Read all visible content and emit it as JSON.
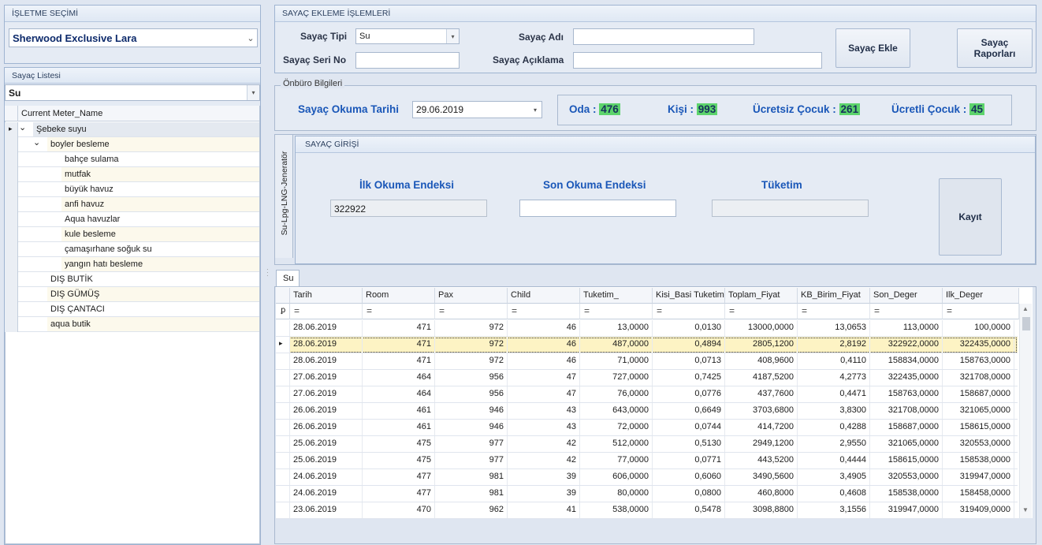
{
  "business": {
    "title": "İŞLETME SEÇİMİ",
    "selected": "Sherwood Exclusive Lara"
  },
  "meterList": {
    "title": "Sayaç Listesi",
    "filter": "Su",
    "column": "Current Meter_Name",
    "items": [
      {
        "label": "Şebeke suyu",
        "level": 0,
        "expand": "⌄"
      },
      {
        "label": "boyler besleme",
        "level": 1,
        "expand": "⌄"
      },
      {
        "label": "bahçe sulama",
        "level": 2
      },
      {
        "label": "mutfak",
        "level": 2
      },
      {
        "label": "büyük havuz",
        "level": 2
      },
      {
        "label": "anfi havuz",
        "level": 2
      },
      {
        "label": "Aqua havuzlar",
        "level": 2
      },
      {
        "label": "kule besleme",
        "level": 2
      },
      {
        "label": "çamaşırhane soğuk su",
        "level": 2
      },
      {
        "label": "yangın hatı besleme",
        "level": 2
      },
      {
        "label": "DIŞ BUTİK",
        "level": 1
      },
      {
        "label": "DIŞ GÜMÜŞ",
        "level": 1
      },
      {
        "label": "DIŞ ÇANTACI",
        "level": 1
      },
      {
        "label": "aqua butik",
        "level": 1
      }
    ]
  },
  "add": {
    "title": "SAYAÇ EKLEME İŞLEMLERİ",
    "typeLabel": "Sayaç Tipi",
    "typeValue": "Su",
    "serialLabel": "Sayaç Seri No",
    "serialValue": "",
    "nameLabel": "Sayaç Adı",
    "nameValue": "",
    "descLabel": "Sayaç Açıklama",
    "descValue": "",
    "addButton": "Sayaç Ekle",
    "reportButton": "Sayaç Raporları"
  },
  "frontOffice": {
    "title": "Önbüro Bilgileri",
    "dateLabel": "Sayaç Okuma Tarihi",
    "dateValue": "29.06.2019",
    "odaLabel": "Oda :",
    "odaValue": "476",
    "kisiLabel": "Kişi :",
    "kisiValue": "993",
    "freeChildLabel": "Ücretsiz Çocuk :",
    "freeChildValue": "261",
    "paidChildLabel": "Ücretli Çocuk :",
    "paidChildValue": "45"
  },
  "entry": {
    "sideTab": "Su-Lpg-LNG-Jeneratör",
    "title": "SAYAÇ GİRİŞİ",
    "firstLabel": "İlk Okuma Endeksi",
    "firstValue": "322922",
    "lastLabel": "Son Okuma Endeksi",
    "lastValue": "",
    "usageLabel": "Tüketim",
    "usageValue": "",
    "saveButton": "Kayıt"
  },
  "grid": {
    "tab": "Su",
    "columns": [
      "Tarih",
      "Room",
      "Pax",
      "Child",
      "Tuketim_",
      "Kisi_Basi Tuketim",
      "Toplam_Fiyat",
      "KB_Birim_Fiyat",
      "Son_Deger",
      "Ilk_Deger"
    ],
    "filterSymbol": "=",
    "filterRowIcon": "ꝑ",
    "rows": [
      [
        "28.06.2019",
        "471",
        "972",
        "46",
        "13,0000",
        "0,0130",
        "13000,0000",
        "13,0653",
        "113,0000",
        "100,0000"
      ],
      [
        "28.06.2019",
        "471",
        "972",
        "46",
        "487,0000",
        "0,4894",
        "2805,1200",
        "2,8192",
        "322922,0000",
        "322435,0000"
      ],
      [
        "28.06.2019",
        "471",
        "972",
        "46",
        "71,0000",
        "0,0713",
        "408,9600",
        "0,4110",
        "158834,0000",
        "158763,0000"
      ],
      [
        "27.06.2019",
        "464",
        "956",
        "47",
        "727,0000",
        "0,7425",
        "4187,5200",
        "4,2773",
        "322435,0000",
        "321708,0000"
      ],
      [
        "27.06.2019",
        "464",
        "956",
        "47",
        "76,0000",
        "0,0776",
        "437,7600",
        "0,4471",
        "158763,0000",
        "158687,0000"
      ],
      [
        "26.06.2019",
        "461",
        "946",
        "43",
        "643,0000",
        "0,6649",
        "3703,6800",
        "3,8300",
        "321708,0000",
        "321065,0000"
      ],
      [
        "26.06.2019",
        "461",
        "946",
        "43",
        "72,0000",
        "0,0744",
        "414,7200",
        "0,4288",
        "158687,0000",
        "158615,0000"
      ],
      [
        "25.06.2019",
        "475",
        "977",
        "42",
        "512,0000",
        "0,5130",
        "2949,1200",
        "2,9550",
        "321065,0000",
        "320553,0000"
      ],
      [
        "25.06.2019",
        "475",
        "977",
        "42",
        "77,0000",
        "0,0771",
        "443,5200",
        "0,4444",
        "158615,0000",
        "158538,0000"
      ],
      [
        "24.06.2019",
        "477",
        "981",
        "39",
        "606,0000",
        "0,6060",
        "3490,5600",
        "3,4905",
        "320553,0000",
        "319947,0000"
      ],
      [
        "24.06.2019",
        "477",
        "981",
        "39",
        "80,0000",
        "0,0800",
        "460,8000",
        "0,4608",
        "158538,0000",
        "158458,0000"
      ],
      [
        "23.06.2019",
        "470",
        "962",
        "41",
        "538,0000",
        "0,5478",
        "3098,8800",
        "3,1556",
        "319947,0000",
        "319409,0000"
      ]
    ],
    "selectedRow": 1,
    "rowIndicator": "▸"
  },
  "icons": {
    "dropdown": "chevron-down-icon",
    "expand": "expand-icon",
    "scroll": "scrollbar"
  }
}
